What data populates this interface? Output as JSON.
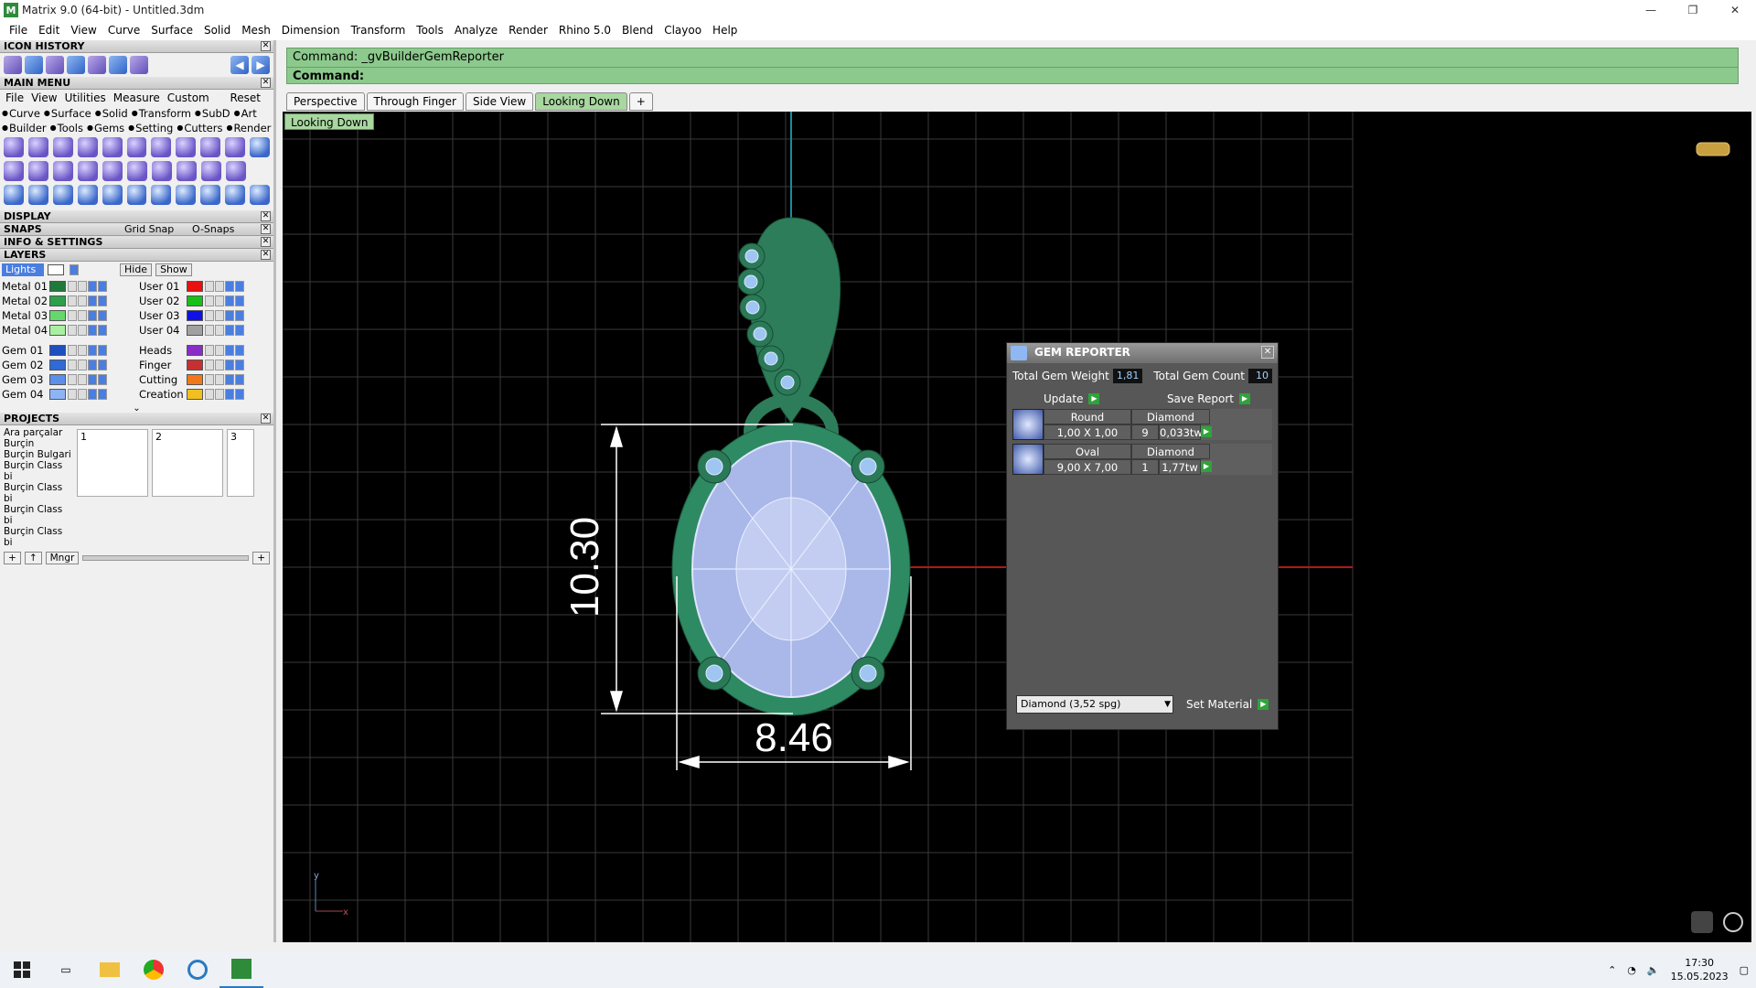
{
  "window": {
    "title": "Matrix 9.0 (64-bit) - Untitled.3dm",
    "controls": [
      "—",
      "❐",
      "✕"
    ]
  },
  "menubar": [
    "File",
    "Edit",
    "View",
    "Curve",
    "Surface",
    "Solid",
    "Mesh",
    "Dimension",
    "Transform",
    "Tools",
    "Analyze",
    "Render",
    "Rhino 5.0",
    "Blend",
    "Clayoo",
    "Help"
  ],
  "left": {
    "icon_history": "ICON HISTORY",
    "main_menu": "MAIN MENU",
    "main_menu_items": [
      "File",
      "View",
      "Utilities",
      "Measure",
      "Custom",
      "Reset"
    ],
    "cats1": [
      "Curve",
      "Surface",
      "Solid",
      "Transform",
      "SubD",
      "Art"
    ],
    "cats2": [
      "Builder",
      "Tools",
      "Gems",
      "Setting",
      "Cutters",
      "Render"
    ],
    "display": "DISPLAY",
    "snaps": "SNAPS",
    "grid_snap": "Grid Snap",
    "osnaps": "O-Snaps",
    "info": "INFO & SETTINGS",
    "layers": "LAYERS",
    "lights": "Lights",
    "hide": "Hide",
    "show": "Show",
    "layers_left": [
      {
        "name": "Metal 01",
        "color": "#1f7a3a"
      },
      {
        "name": "Metal 02",
        "color": "#2da04a"
      },
      {
        "name": "Metal 03",
        "color": "#64d86a"
      },
      {
        "name": "Metal 04",
        "color": "#a8f0a0"
      },
      {
        "name": "Gem 01",
        "color": "#1e4fbf"
      },
      {
        "name": "Gem 02",
        "color": "#2f6ad8"
      },
      {
        "name": "Gem 03",
        "color": "#5b8fea"
      },
      {
        "name": "Gem 04",
        "color": "#8db4f4"
      }
    ],
    "layers_right": [
      {
        "name": "User 01",
        "color": "#e81010"
      },
      {
        "name": "User 02",
        "color": "#18c018"
      },
      {
        "name": "User 03",
        "color": "#1010e8"
      },
      {
        "name": "User 04",
        "color": "#a0a0a0"
      },
      {
        "name": "Heads",
        "color": "#8a2cc8"
      },
      {
        "name": "Finger",
        "color": "#c83030"
      },
      {
        "name": "Cutting",
        "color": "#f07818"
      },
      {
        "name": "Creation",
        "color": "#f0c020"
      }
    ],
    "projects": "PROJECTS",
    "project_list": [
      "Ara parçalar",
      "Burçin",
      "Burçin Bulgari",
      "Burçin Class bi",
      "Burçin Class bi",
      "Burçin Class bi",
      "Burçin Class bi"
    ],
    "thumbs": [
      "1",
      "2",
      "3"
    ],
    "mngr": "Mngr"
  },
  "command": {
    "line1": "Command: _gvBuilderGemReporter",
    "line2": "Command:"
  },
  "tabs": [
    "Perspective",
    "Through Finger",
    "Side View",
    "Looking Down"
  ],
  "active_tab": "Looking Down",
  "viewport_label": "Looking Down",
  "dimensions": {
    "vertical": "10.30",
    "horizontal": "8.46"
  },
  "axis": {
    "y": "y",
    "x": "x"
  },
  "gem_reporter": {
    "title": "GEM REPORTER",
    "total_weight_label": "Total Gem Weight",
    "total_weight": "1,81",
    "total_count_label": "Total Gem Count",
    "total_count": "10",
    "update": "Update",
    "save_report": "Save Report",
    "rows": [
      {
        "shape": "Round",
        "material": "Diamond",
        "size": "1,00 X 1,00",
        "count": "9",
        "weight": "0,033tw"
      },
      {
        "shape": "Oval",
        "material": "Diamond",
        "size": "9,00 X 7,00",
        "count": "1",
        "weight": "1,77tw"
      }
    ],
    "material_select": "Diamond    (3,52 spg)",
    "set_material": "Set Material"
  },
  "taskbar": {
    "time": "17:30",
    "date": "15.05.2023"
  }
}
